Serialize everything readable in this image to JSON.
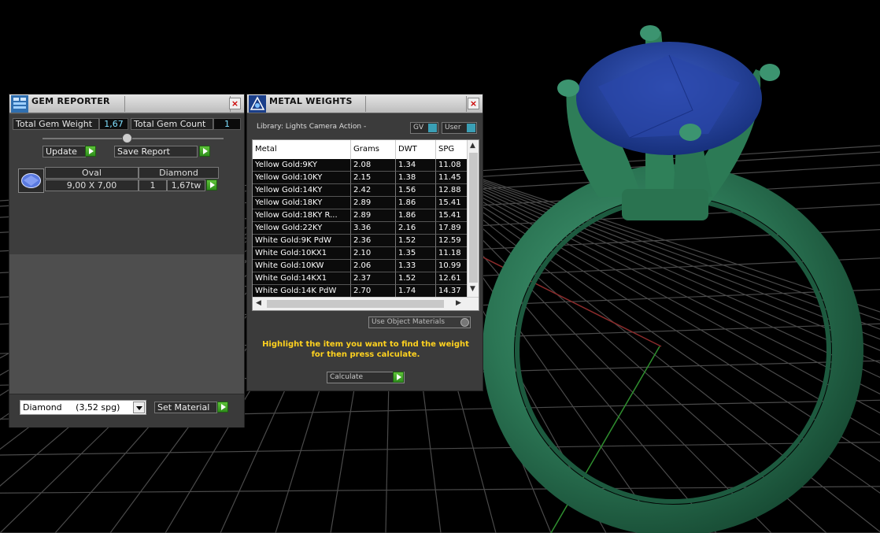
{
  "colors": {
    "accent_green": "#4caf2f",
    "hint_yellow": "#ffd21f",
    "value_cyan": "#7fe0ff",
    "ring_green": "#2f7d5a",
    "gem_blue": "#243f9c"
  },
  "gem_reporter": {
    "title": "GEM REPORTER",
    "total_weight_label": "Total Gem Weight",
    "total_weight_value": "1,67",
    "total_count_label": "Total Gem Count",
    "total_count_value": "1",
    "update_label": "Update",
    "save_report_label": "Save Report",
    "gem": {
      "shape": "Oval",
      "material": "Diamond",
      "size": "9,00 X 7,00",
      "qty": "1",
      "weight": "1,67tw",
      "icon": "oval-gem-icon"
    },
    "material_select": "Diamond     (3,52 spg)",
    "set_material_label": "Set Material"
  },
  "metal_weights": {
    "title": "METAL WEIGHTS",
    "library": "Library: Lights Camera Action -",
    "gv_label": "GV",
    "user_label": "User",
    "columns": [
      "Metal",
      "Grams",
      "DWT",
      "SPG"
    ],
    "rows": [
      [
        "Yellow Gold:9KY",
        "2.08",
        "1.34",
        "11.08"
      ],
      [
        "Yellow Gold:10KY",
        "2.15",
        "1.38",
        "11.45"
      ],
      [
        "Yellow Gold:14KY",
        "2.42",
        "1.56",
        "12.88"
      ],
      [
        "Yellow Gold:18KY",
        "2.89",
        "1.86",
        "15.41"
      ],
      [
        "Yellow Gold:18KY R...",
        "2.89",
        "1.86",
        "15.41"
      ],
      [
        "Yellow Gold:22KY",
        "3.36",
        "2.16",
        "17.89"
      ],
      [
        "White Gold:9K PdW",
        "2.36",
        "1.52",
        "12.59"
      ],
      [
        "White Gold:10KX1",
        "2.10",
        "1.35",
        "11.18"
      ],
      [
        "White Gold:10KW",
        "2.06",
        "1.33",
        "10.99"
      ],
      [
        "White Gold:14KX1",
        "2.37",
        "1.52",
        "12.61"
      ],
      [
        "White Gold:14K PdW",
        "2.70",
        "1.74",
        "14.37"
      ]
    ],
    "use_object_materials": "Use Object Materials",
    "hint_line1": "Highlight the item you want to find the weight",
    "hint_line2": "for then press calculate.",
    "calculate_label": "Calculate"
  }
}
